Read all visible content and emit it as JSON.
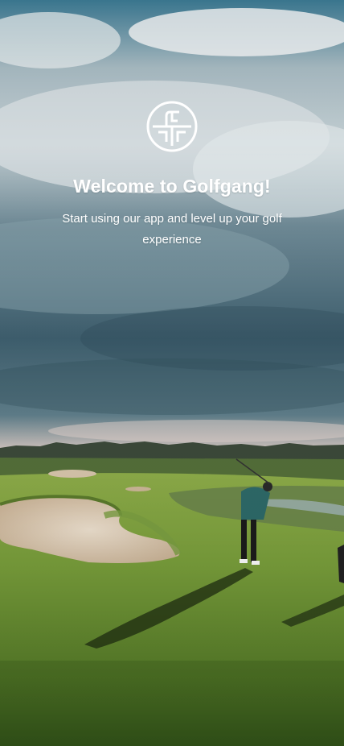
{
  "welcome": {
    "logo_icon": "golfgang-logo-icon",
    "title": "Welcome to Golfgang!",
    "subtitle": "Start using our app and level up your golf experience"
  },
  "colors": {
    "sky_top": "#2f6f88",
    "sky_mid": "#6f8c99",
    "cloud": "#e4ecef",
    "fairway": "#7fa03c",
    "fairway_dark": "#4f7a25",
    "sand": "#e7d6bf",
    "text": "#ffffff"
  }
}
